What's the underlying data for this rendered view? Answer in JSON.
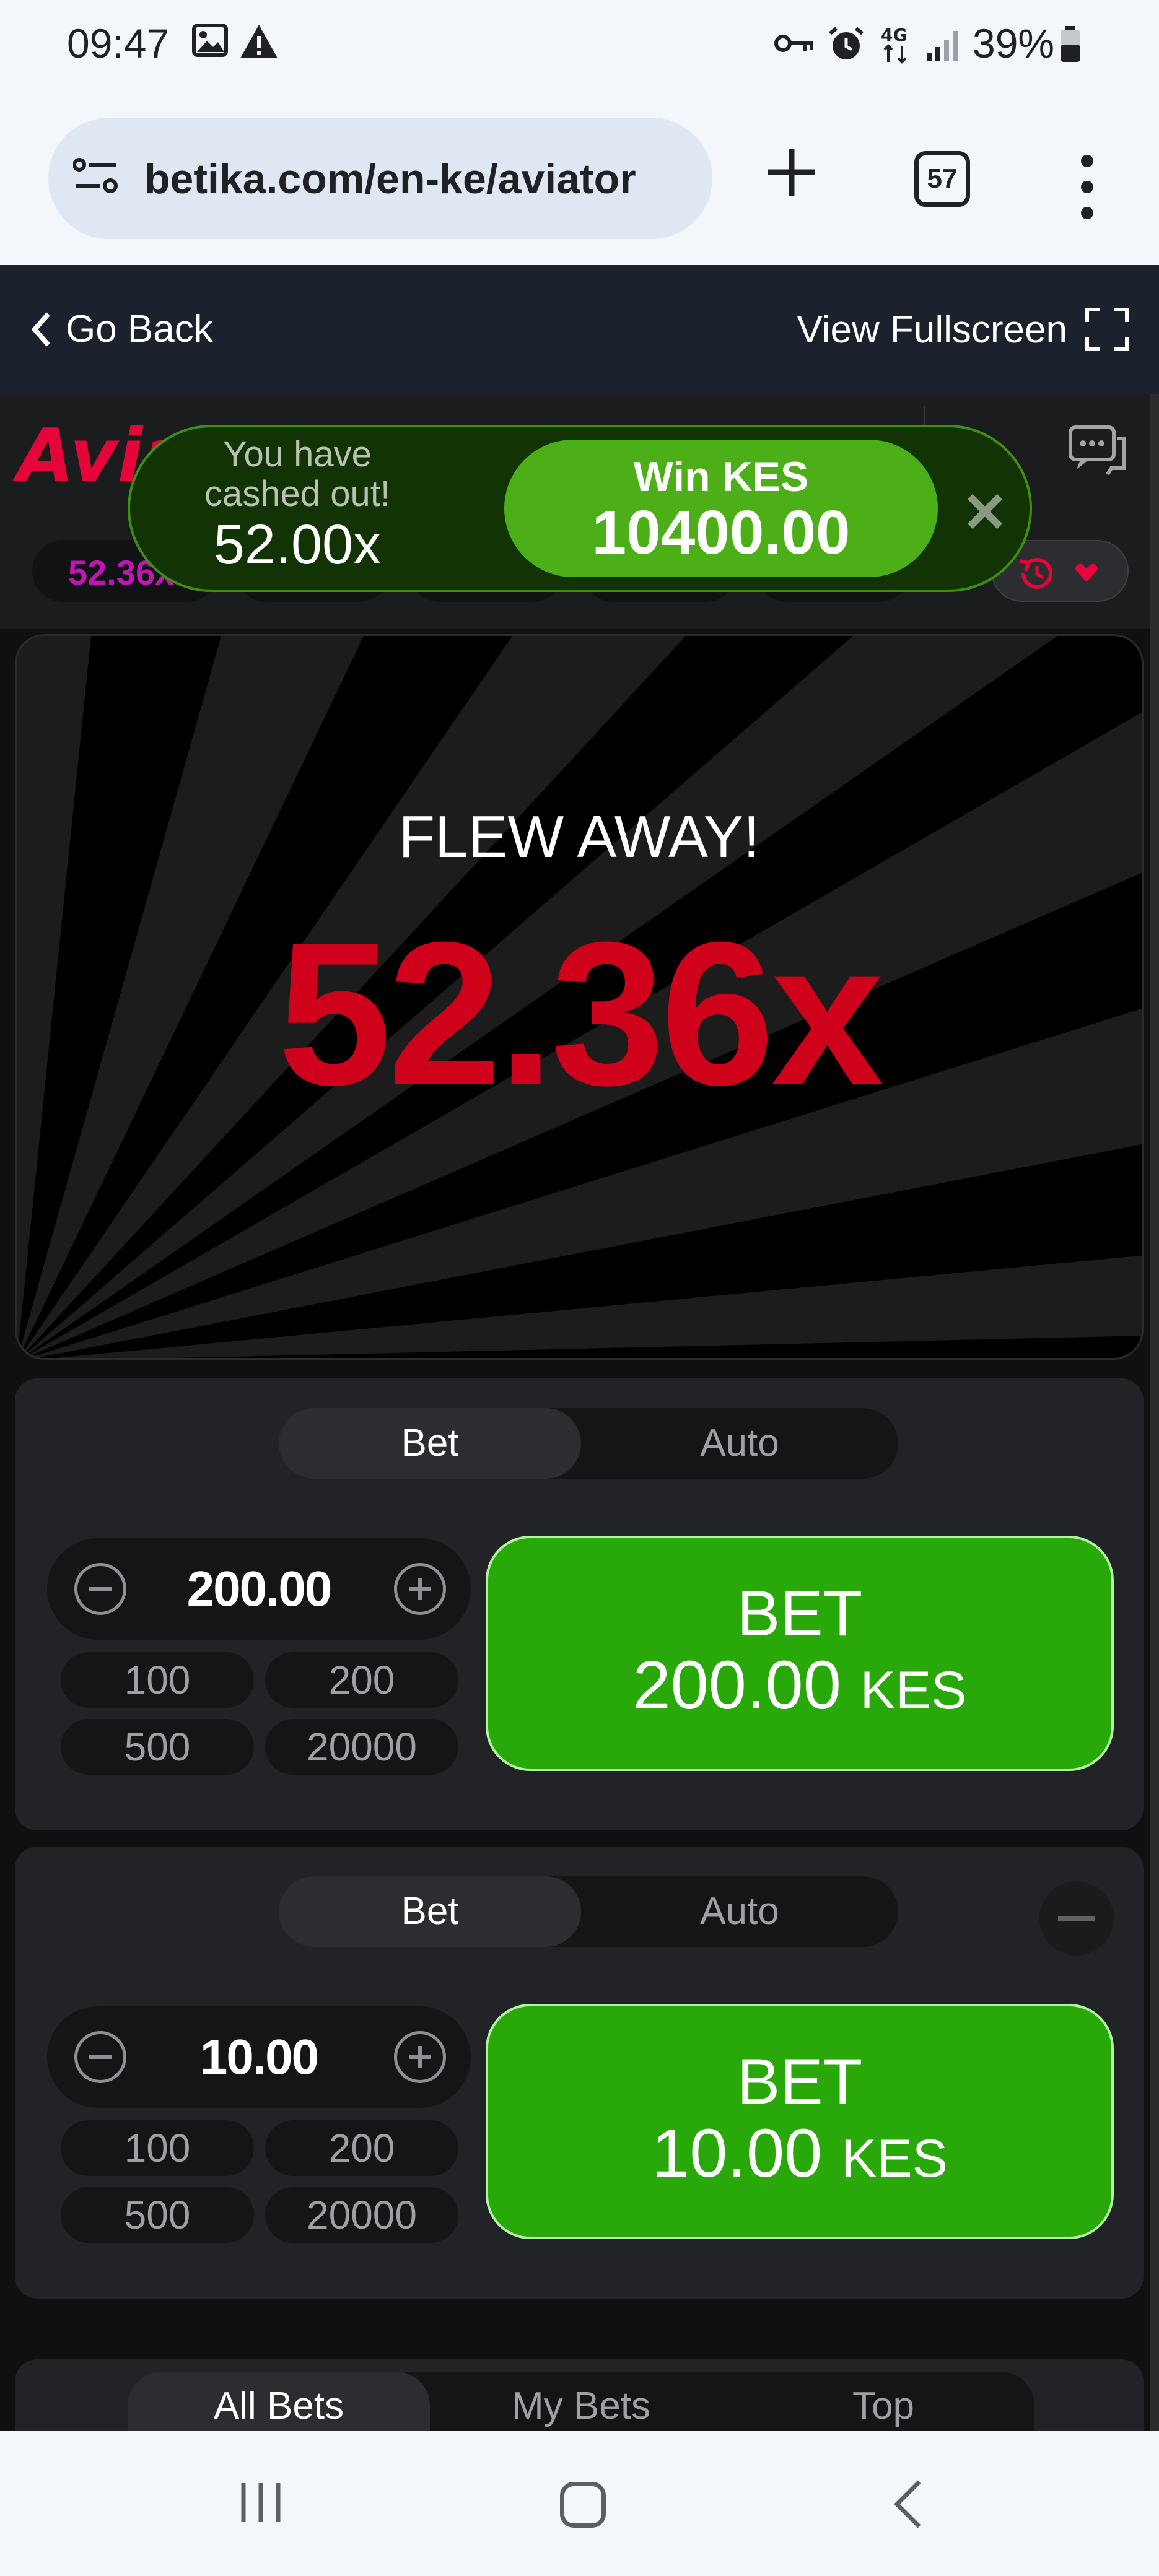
{
  "status_bar": {
    "time": "09:47",
    "battery": "39%",
    "icons": [
      "image-icon",
      "warning-icon",
      "key-icon",
      "alarm-icon",
      "4g-icon",
      "signal-icon",
      "battery-icon"
    ]
  },
  "browser": {
    "url": "betika.com/en-ke/aviator",
    "tab_count": "57"
  },
  "top_nav": {
    "go_back": "Go Back",
    "fullscreen": "View Fullscreen"
  },
  "game_header": {
    "logo": "Aviator",
    "last_multiplier": "52.36x"
  },
  "toast": {
    "message": "You have cashed out!",
    "multiplier": "52.00x",
    "win_label": "Win KES",
    "win_amount": "10400.00"
  },
  "canvas": {
    "status": "FLEW AWAY!",
    "crash_multiplier": "52.36x"
  },
  "bet_panels": [
    {
      "tab_bet": "Bet",
      "tab_auto": "Auto",
      "amount": "200.00",
      "quick": [
        "100",
        "200",
        "500",
        "20000"
      ],
      "button_label": "BET",
      "button_amount": "200.00",
      "currency": "KES"
    },
    {
      "tab_bet": "Bet",
      "tab_auto": "Auto",
      "amount": "10.00",
      "quick": [
        "100",
        "200",
        "500",
        "20000"
      ],
      "button_label": "BET",
      "button_amount": "10.00",
      "currency": "KES"
    }
  ],
  "bets_tabs": [
    "All Bets",
    "My Bets",
    "Top"
  ],
  "colors": {
    "accent_red": "#d0011b",
    "bet_green": "#28a909",
    "win_green": "#4caf17",
    "multiplier_purple": "#c017b4"
  }
}
